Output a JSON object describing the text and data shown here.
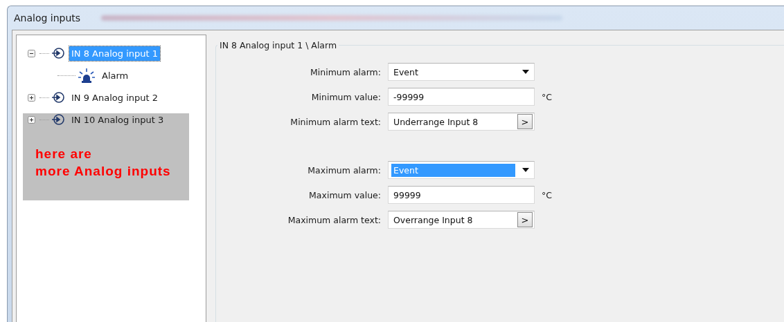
{
  "window": {
    "title": "Analog inputs"
  },
  "tree": {
    "items": [
      {
        "label": "IN 8 Analog input 1",
        "kind": "input",
        "selected": true,
        "expanded": true,
        "children": [
          {
            "label": "Alarm",
            "kind": "alarm",
            "selected": false
          }
        ]
      },
      {
        "label": "IN 9 Analog input 2",
        "kind": "input",
        "selected": false,
        "expanded": false
      },
      {
        "label": "IN 10 Analog input 3",
        "kind": "input",
        "selected": false,
        "expanded": false
      }
    ]
  },
  "note": {
    "lines": [
      "here are",
      "more Analog inputs"
    ]
  },
  "group": {
    "title": "IN 8 Analog input 1 \\ Alarm",
    "field_groups": [
      [
        {
          "kind": "select",
          "label": "Minimum alarm:",
          "value": "Event",
          "selected": false
        },
        {
          "kind": "number",
          "label": "Minimum value:",
          "value": "-99999",
          "unit": "°C"
        },
        {
          "kind": "text",
          "label": "Minimum alarm text:",
          "value": "Underrange Input 8",
          "button": ">"
        }
      ],
      [
        {
          "kind": "select",
          "label": "Maximum alarm:",
          "value": "Event",
          "selected": true
        },
        {
          "kind": "number",
          "label": "Maximum value:",
          "value": "99999",
          "unit": "°C"
        },
        {
          "kind": "text",
          "label": "Maximum alarm text:",
          "value": "Overrange Input 8",
          "button": ">"
        }
      ]
    ]
  }
}
